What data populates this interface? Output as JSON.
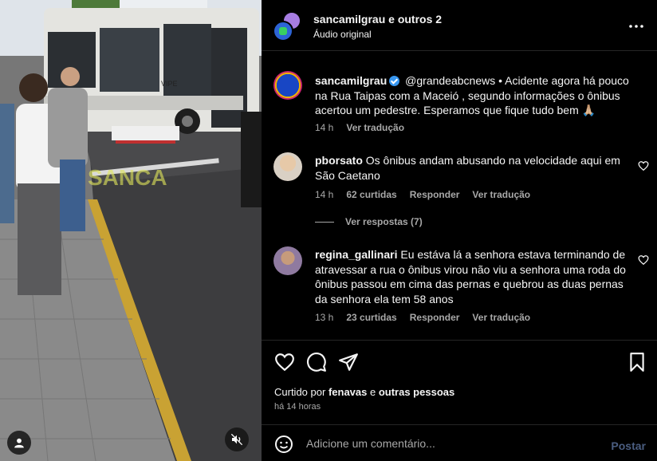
{
  "header": {
    "owner": "sancamilgrau",
    "others": "e outros 2",
    "audio": "Áudio original",
    "more_icon": "more-horizontal-icon"
  },
  "caption": {
    "username": "sancamilgrau",
    "text": "@grandeabcnews • Acidente agora há pouco na Rua Taipas com a Maceió , segundo informações o ônibus acertou um pedestre. Esperamos que fique tudo bem 🙏🏼",
    "time": "14 h",
    "translate": "Ver tradução"
  },
  "comments": [
    {
      "username": "pborsato",
      "text": "Os ônibus andam abusando na velocidade aqui em São Caetano",
      "time": "14 h",
      "likes": "62 curtidas",
      "reply": "Responder",
      "translate": "Ver tradução",
      "view_replies": "Ver respostas (7)"
    },
    {
      "username": "regina_gallinari",
      "text": "Eu estáva lá a senhora estava terminando de atravessar a rua o ônibus virou não viu a senhora uma roda do ônibus passou em cima das pernas e quebrou as duas pernas da senhora ela tem 58 anos",
      "time": "13 h",
      "likes": "23 curtidas",
      "reply": "Responder",
      "translate": "Ver tradução"
    }
  ],
  "likes": {
    "prefix": "Curtido por",
    "user": "fenavas",
    "joiner": "e",
    "others": "outras pessoas"
  },
  "timestamp": "há 14 horas",
  "composer": {
    "placeholder": "Adicione um comentário...",
    "post_label": "Postar"
  },
  "media": {
    "bus_sign": "VIPE",
    "watermark": "SANCA"
  },
  "colors": {
    "background": "#000000",
    "text": "#f5f5f5",
    "muted": "#a8a8a8",
    "divider": "#262626",
    "post_disabled": "#4a5d80",
    "verified": "#3897f0"
  }
}
